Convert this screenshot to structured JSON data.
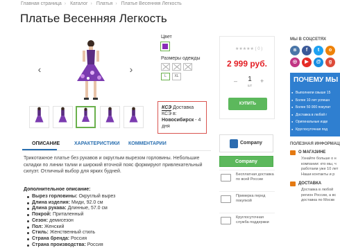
{
  "breadcrumb": [
    "Главная страница",
    "Каталог",
    "Платья",
    "Платье Весенняя Легкость"
  ],
  "title": "Платье Весенняя Легкость",
  "options": {
    "color_label": "Цвет",
    "color_value": "#8a2bb8",
    "sizes_label": "Размеры одежды",
    "sizes": [
      "",
      "",
      "",
      "L",
      "XL"
    ]
  },
  "delivery": {
    "logo": "КСЭ",
    "line1": "Доставка КСЭ в:",
    "city": "Новосибирск",
    "days": " - 4 дня"
  },
  "buy": {
    "rating": "★★★★★ ( 0 )",
    "price": "2 999 руб.",
    "qty_minus": "–",
    "qty": "1",
    "qty_plus": "+",
    "unit": "шт",
    "buy_label": "КУПИТЬ"
  },
  "tabs": [
    "ОПИСАНИЕ",
    "ХАРАКТЕРИСТИКИ",
    "КОММЕНТАРИИ"
  ],
  "description": "Трикотажное платье без рукавов и округлым вырезом горловины. Небольшие складки по линии талии и широкий вточной пояс формируют привлекательный силуэт. Отличный выбор для ярких будней.",
  "specs_heading": "Дополнительное описание:",
  "specs": [
    {
      "k": "Вырез горловины:",
      "v": " Округлый вырез"
    },
    {
      "k": "Длина изделия:",
      "v": " Миди, 92.0 см"
    },
    {
      "k": "Длина рукава:",
      "v": " Длинные, 57.0 см"
    },
    {
      "k": "Покрой:",
      "v": " Приталенный"
    },
    {
      "k": "Сезон:",
      "v": " демисезон"
    },
    {
      "k": "Пол:",
      "v": " Женский"
    },
    {
      "k": "Стиль:",
      "v": " Женственный стиль"
    },
    {
      "k": "Страна бренда:",
      "v": " Россия"
    },
    {
      "k": "Страна производства:",
      "v": " Россия"
    }
  ],
  "badges": {
    "company1": "Company",
    "company2": "Company",
    "features": [
      "Бесплатная доставка по всей России",
      "Примерка перед покупкой",
      "Круглосуточная служба поддержки"
    ]
  },
  "sidebar": {
    "social_head": "МЫ В СОЦСЕТЯХ",
    "socials": [
      {
        "name": "vk-icon",
        "glyph": "в",
        "color": "#4a76a8"
      },
      {
        "name": "facebook-icon",
        "glyph": "f",
        "color": "#3b5998"
      },
      {
        "name": "twitter-icon",
        "glyph": "t",
        "color": "#1da1f2"
      },
      {
        "name": "odnoklassniki-icon",
        "glyph": "о",
        "color": "#ee8208"
      },
      {
        "name": "instagram-icon",
        "glyph": "◎",
        "color": "#c13584"
      },
      {
        "name": "youtube-icon",
        "glyph": "▶",
        "color": "#e52d27"
      },
      {
        "name": "mailru-icon",
        "glyph": "@",
        "color": "#168de2"
      },
      {
        "name": "googleplus-icon",
        "glyph": "g",
        "color": "#dd4b39"
      }
    ],
    "promo_title": "ПОЧЕМУ МЫ",
    "promo_items": [
      "Выполнили свыше 15",
      "Более 10 лет успешн",
      "Более 50 000 покупат",
      "Доставка в любой г",
      "Оригинальные изде",
      "Круглосуточная под"
    ],
    "info_head": "ПОЛЕЗНАЯ ИНФОРМАЦИЯ",
    "info": [
      {
        "title": "О МАГАЗИНЕ",
        "desc": "Узнайте больше о н компании: кто мы, ч работаем уже 10 лет Наши контакты и р"
      },
      {
        "title": "ДОСТАВКА",
        "desc": "Доставка в любой регион России, а вс доставка по Москв"
      }
    ]
  }
}
